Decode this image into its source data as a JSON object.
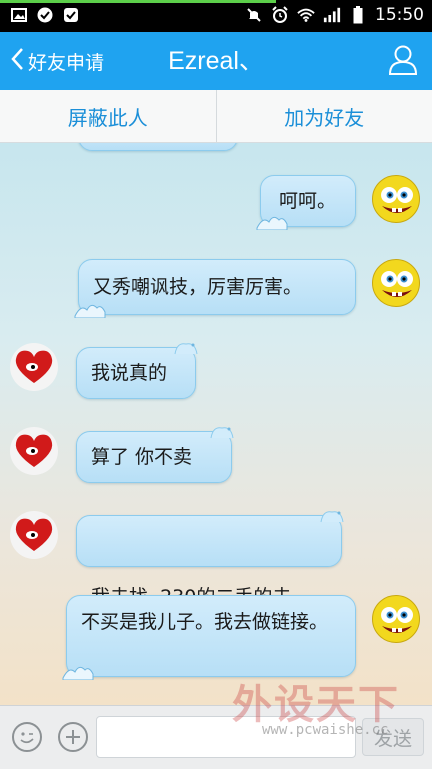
{
  "status_bar": {
    "time": "15:50",
    "left_icons": [
      "image-icon",
      "check-circle-icon",
      "checkbox-icon"
    ],
    "right_icons": [
      "mute-icon",
      "alarm-icon",
      "wifi-icon",
      "signal-icon",
      "battery-icon"
    ]
  },
  "header": {
    "back_label": "好友申请",
    "title": "Ezreal、",
    "profile_icon": "person-icon"
  },
  "actions": {
    "block_label": "屏蔽此人",
    "add_friend_label": "加为好友"
  },
  "messages": [
    {
      "side": "right",
      "text": "呵呵。"
    },
    {
      "side": "right",
      "text": "又秀嘲讽技，厉害厉害。"
    },
    {
      "side": "left",
      "text": "我说真的"
    },
    {
      "side": "left",
      "text": "算了 你不卖"
    },
    {
      "side": "left",
      "text": "我去找  230的二手的去"
    },
    {
      "side": "right",
      "text": "不买是我儿子。我去做链接。"
    }
  ],
  "input_bar": {
    "emoji_icon": "smiley-icon",
    "plus_icon": "plus-icon",
    "input_value": "",
    "send_label": "发送"
  },
  "watermark": {
    "title": "外设天下",
    "url": "www.pcwaishe.cc"
  },
  "colors": {
    "header_bg": "#1fa3f0",
    "action_text": "#1b8fd8",
    "bubble_bg": "#c6e6f8"
  }
}
